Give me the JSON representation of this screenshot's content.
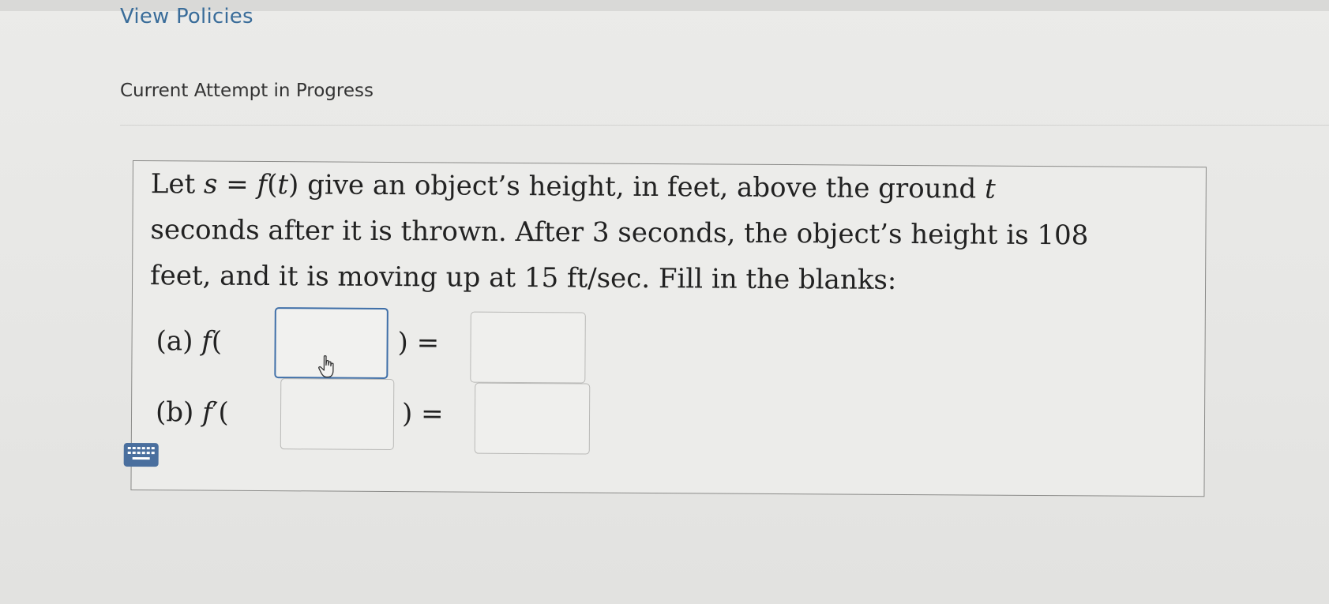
{
  "header": {
    "view_policies": "View Policies",
    "attempt_heading": "Current Attempt in Progress"
  },
  "question": {
    "line1_a": "Let ",
    "line1_s": "s",
    "line1_b": " = ",
    "line1_f": "f",
    "line1_c": "(",
    "line1_t": "t",
    "line1_d": ") give an object’s height, in feet, above the ground ",
    "line1_t2": "t",
    "line2": "seconds after it is thrown. After 3 seconds, the object’s height is 108",
    "line3": "feet, and it is moving up at 15 ft/sec. Fill in the blanks:"
  },
  "parts": {
    "a": {
      "label_prefix": "(a) ",
      "func": "f",
      "open": "(",
      "close_eq": ") =",
      "arg_value": "",
      "result_value": ""
    },
    "b": {
      "label_prefix": "(b) ",
      "func": "f",
      "prime": "′",
      "open": "(",
      "close_eq": ") =",
      "arg_value": "",
      "result_value": ""
    }
  },
  "icons": {
    "keyboard": "keyboard-icon",
    "cursor": "hand-pointer-icon"
  },
  "colors": {
    "link": "#3a6d9a",
    "focus_border": "#3f6fa8",
    "keyboard_bg": "#4a6f9e"
  }
}
